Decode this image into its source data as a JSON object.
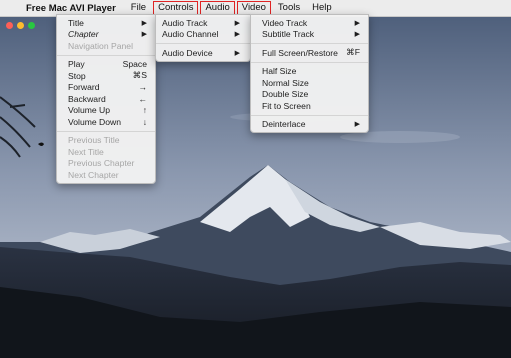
{
  "menubar": {
    "apple_glyph": "",
    "app_name": "Free Mac AVI Player",
    "items": [
      {
        "label": "File"
      },
      {
        "label": "Controls"
      },
      {
        "label": "Audio"
      },
      {
        "label": "Video"
      },
      {
        "label": "Tools"
      },
      {
        "label": "Help"
      }
    ]
  },
  "controls_menu": {
    "title": "Title",
    "chapter": "Chapter",
    "navigation_panel": "Navigation Panel",
    "play": "Play",
    "play_shortcut": "Space",
    "stop": "Stop",
    "stop_shortcut": "⌘S",
    "forward": "Forward",
    "forward_shortcut": "→",
    "backward": "Backward",
    "backward_shortcut": "←",
    "volume_up": "Volume Up",
    "volume_up_shortcut": "↑",
    "volume_down": "Volume Down",
    "volume_down_shortcut": "↓",
    "previous_title": "Previous Title",
    "next_title": "Next Title",
    "previous_chapter": "Previous Chapter",
    "next_chapter": "Next Chapter"
  },
  "audio_menu": {
    "audio_track": "Audio Track",
    "audio_channel": "Audio Channel",
    "audio_device": "Audio Device"
  },
  "video_menu": {
    "video_track": "Video Track",
    "subtitle_track": "Subtitle Track",
    "full_screen": "Full Screen/Restore",
    "full_screen_shortcut": "⌘F",
    "half_size": "Half Size",
    "normal_size": "Normal Size",
    "double_size": "Double Size",
    "fit_to_screen": "Fit to Screen",
    "deinterlace": "Deinterlace"
  },
  "submenu_arrow": "▶",
  "colors": {
    "highlight_border": "#e02424",
    "traffic_close": "#ff5f57",
    "traffic_minimize": "#febc2e",
    "traffic_zoom": "#28c840"
  }
}
